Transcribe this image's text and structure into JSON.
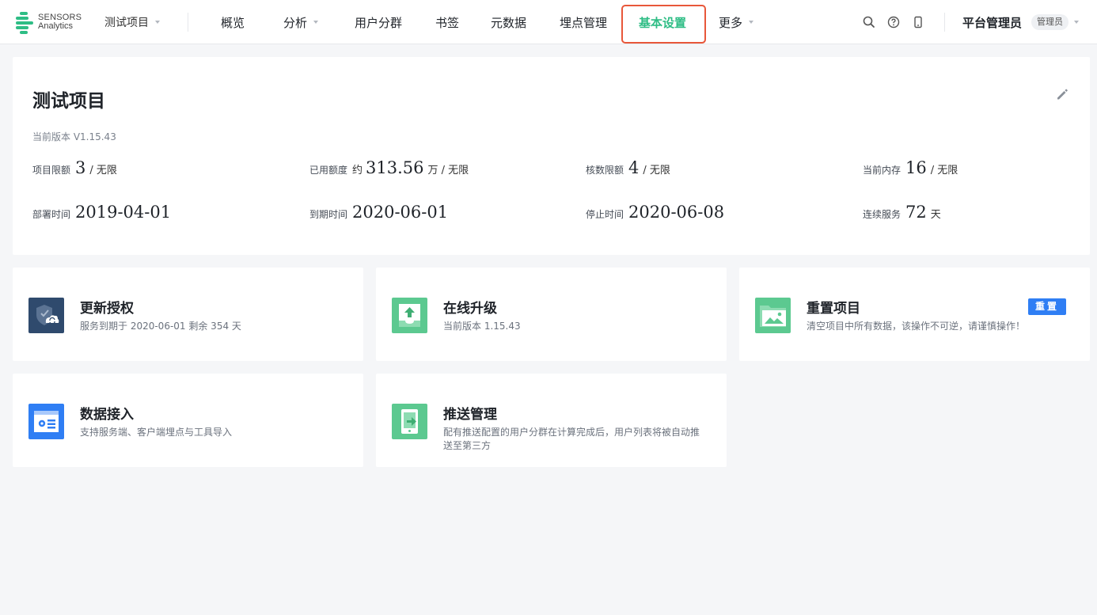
{
  "header": {
    "logo": {
      "line1": "SENSORS",
      "line2": "Analytics"
    },
    "project_select": "测试项目",
    "nav": [
      {
        "label": "概览",
        "has_caret": false
      },
      {
        "label": "分析",
        "has_caret": true
      },
      {
        "label": "用户分群",
        "has_caret": false
      },
      {
        "label": "书签",
        "has_caret": false
      },
      {
        "label": "元数据",
        "has_caret": false
      },
      {
        "label": "埋点管理",
        "has_caret": false
      },
      {
        "label": "基本设置",
        "has_caret": false,
        "active": true
      },
      {
        "label": "更多",
        "has_caret": true
      }
    ],
    "icons": [
      "search-icon",
      "help-icon",
      "mobile-icon"
    ],
    "user_name": "平台管理员",
    "role_badge": "管理员"
  },
  "project": {
    "title": "测试项目",
    "version": "当前版本 V1.15.43",
    "stats": [
      {
        "label": "项目限额",
        "prefix": "",
        "value": "3",
        "unit": "/ 无限"
      },
      {
        "label": "已用额度",
        "prefix": "约",
        "value": "313.56",
        "unit": "万 / 无限"
      },
      {
        "label": "核数限额",
        "prefix": "",
        "value": "4",
        "unit": "/ 无限"
      },
      {
        "label": "当前内存",
        "prefix": "",
        "value": "16",
        "unit": "/ 无限"
      },
      {
        "label": "部署时间",
        "prefix": "",
        "value": "2019-04-01",
        "unit": ""
      },
      {
        "label": "到期时间",
        "prefix": "",
        "value": "2020-06-01",
        "unit": ""
      },
      {
        "label": "停止时间",
        "prefix": "",
        "value": "2020-06-08",
        "unit": ""
      },
      {
        "label": "连续服务",
        "prefix": "",
        "value": "72",
        "unit": "天"
      }
    ]
  },
  "cards": [
    {
      "title": "更新授权",
      "desc": "服务到期于 2020-06-01 剩余 354 天",
      "icon": "license-shield-icon",
      "color": "#2f4a6d"
    },
    {
      "title": "在线升级",
      "desc": "当前版本 1.15.43",
      "icon": "upgrade-icon",
      "color": "#5cc990"
    },
    {
      "title": "重置项目",
      "desc": "清空项目中所有数据，该操作不可逆，请谨慎操作！",
      "icon": "reset-folder-icon",
      "color": "#5cc990",
      "button": "重置"
    },
    {
      "title": "数据接入",
      "desc": "支持服务端、客户端埋点与工具导入",
      "icon": "data-access-icon",
      "color": "#2f7ef4"
    },
    {
      "title": "推送管理",
      "desc": "配有推送配置的用户分群在计算完成后，用户列表将被自动推送至第三方",
      "icon": "push-icon",
      "color": "#5cc990"
    }
  ],
  "colors": {
    "accent": "#2ebd85",
    "highlight_border": "#e8573a",
    "primary_button": "#2f7ef4"
  }
}
